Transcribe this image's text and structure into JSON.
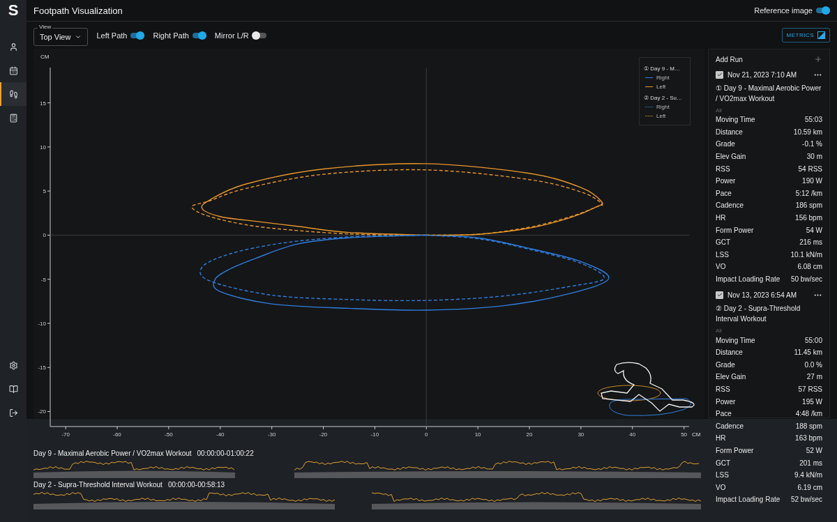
{
  "sidebar": {
    "logo": "S",
    "items": [
      {
        "selected": false
      },
      {
        "selected": false
      },
      {
        "selected": true
      },
      {
        "selected": false
      }
    ],
    "bottom_items": [
      {
        "selected": false
      },
      {
        "selected": false
      },
      {
        "selected": false
      }
    ]
  },
  "header": {
    "title": "Footpath Visualization",
    "reference_image": {
      "label": "Reference image",
      "on": true
    }
  },
  "toolbar": {
    "view": {
      "label": "View",
      "value": "Top View"
    },
    "toggles": [
      {
        "label": "Left Path",
        "on": true
      },
      {
        "label": "Right Path",
        "on": true
      },
      {
        "label": "Mirror L/R",
        "on": false
      }
    ],
    "metrics_button": "METRICS"
  },
  "plot": {
    "legend": [
      {
        "title": "① Day 9 - M…",
        "entries": [
          {
            "label": "Right",
            "color": "#2f7fe0"
          },
          {
            "label": "Left",
            "color": "#e8962a"
          }
        ]
      },
      {
        "title": "② Day 2 - Su…",
        "entries": [
          {
            "label": "Right",
            "color": "#2f7fe0"
          },
          {
            "label": "Left",
            "color": "#e8962a"
          }
        ]
      }
    ],
    "chart_data": {
      "type": "line",
      "xlabel": "CM",
      "ylabel": "CM",
      "xlim": [
        -73,
        51
      ],
      "ylim": [
        -21.7,
        19
      ],
      "xticks": [
        -70,
        -60,
        -50,
        -40,
        -30,
        -20,
        -10,
        0,
        10,
        20,
        30,
        40,
        50
      ],
      "yticks": [
        -20,
        -15,
        -10,
        -5,
        0,
        5,
        10,
        15
      ]
    }
  },
  "runs_panel": {
    "title": "Add Run",
    "runs": [
      {
        "checked": true,
        "date": "Nov 21, 2023 7:10 AM",
        "name": "① Day 9 - Maximal Aerobic Power / VO2max Workout",
        "filter": "All",
        "metrics": [
          [
            "Moving Time",
            "55:03"
          ],
          [
            "Distance",
            "10.59 km"
          ],
          [
            "Grade",
            "-0.1 %"
          ],
          [
            "Elev Gain",
            "30 m"
          ],
          [
            "RSS",
            "54 RSS"
          ],
          [
            "Power",
            "190 W"
          ],
          [
            "Pace",
            "5:12 /km"
          ],
          [
            "Cadence",
            "186 spm"
          ],
          [
            "HR",
            "156 bpm"
          ],
          [
            "Form Power",
            "54 W"
          ],
          [
            "GCT",
            "216 ms"
          ],
          [
            "LSS",
            "10.1 kN/m"
          ],
          [
            "VO",
            "6.08 cm"
          ],
          [
            "Impact Loading Rate",
            "50 bw/sec"
          ]
        ]
      },
      {
        "checked": true,
        "date": "Nov 13, 2023 6:54 AM",
        "name": "② Day 2 - Supra-Threshold Interval Workout",
        "filter": "All",
        "metrics": [
          [
            "Moving Time",
            "55:00"
          ],
          [
            "Distance",
            "11.45 km"
          ],
          [
            "Grade",
            "0.0 %"
          ],
          [
            "Elev Gain",
            "27 m"
          ],
          [
            "RSS",
            "57 RSS"
          ],
          [
            "Power",
            "195 W"
          ],
          [
            "Pace",
            "4:48 /km"
          ],
          [
            "Cadence",
            "188 spm"
          ],
          [
            "HR",
            "163 bpm"
          ],
          [
            "Form Power",
            "52 W"
          ],
          [
            "GCT",
            "201 ms"
          ],
          [
            "LSS",
            "9.4 kN/m"
          ],
          [
            "VO",
            "6.19 cm"
          ],
          [
            "Impact Loading Rate",
            "52 bw/sec"
          ]
        ]
      }
    ]
  },
  "timeline": [
    {
      "title": "Day 9 - Maximal Aerobic Power / VO2max Workout",
      "range": "00:00:00-01:00:22"
    },
    {
      "title": "Day 2 - Supra-Threshold Interval Workout",
      "range": "00:00:00-00:58:13"
    }
  ]
}
